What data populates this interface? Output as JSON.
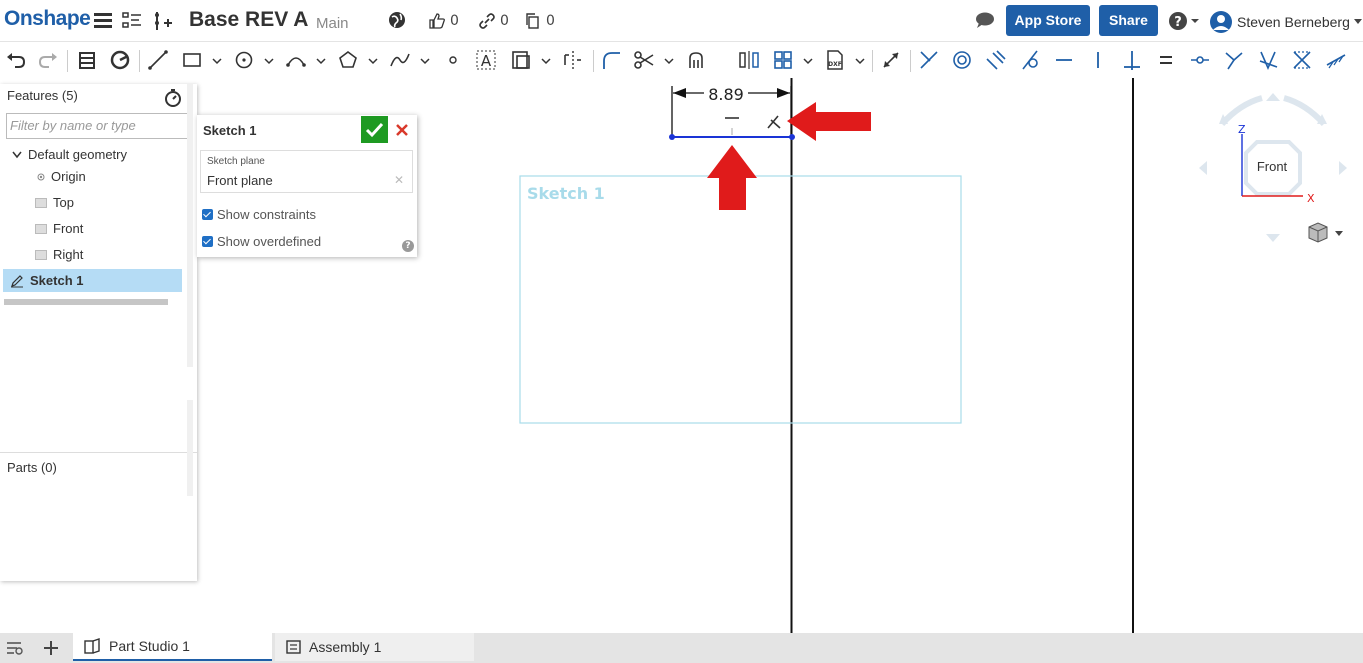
{
  "app": {
    "logo": "Onshape"
  },
  "document": {
    "title": "Base REV A",
    "branch": "Main",
    "likes": "0",
    "links": "0",
    "copies": "0"
  },
  "header": {
    "app_store_label": "App Store",
    "share_label": "Share",
    "user_name": "Steven Berneberg"
  },
  "features_panel": {
    "title": "Features (5)",
    "filter_placeholder": "Filter by name or type",
    "default_geometry_label": "Default geometry",
    "items": [
      "Origin",
      "Top",
      "Front",
      "Right"
    ],
    "selected_item": "Sketch 1",
    "parts_title": "Parts (0)"
  },
  "sketch_dialog": {
    "title": "Sketch 1",
    "plane_label": "Sketch plane",
    "plane_value": "Front plane",
    "show_constraints_label": "Show constraints",
    "show_overdefined_label": "Show overdefined"
  },
  "viewport": {
    "sketch_label": "Sketch 1",
    "dimension_value": "8.89",
    "view_cube_face": "Front",
    "axis_z": "Z",
    "axis_x": "X"
  },
  "bottom_tabs": [
    {
      "label": "Part Studio 1",
      "active": true
    },
    {
      "label": "Assembly 1",
      "active": false
    }
  ],
  "colors": {
    "brand": "#1f5fa8",
    "ok_green": "#1e9a22",
    "cancel_red": "#d9392b",
    "selection": "#b5dcf5",
    "sketch_line": "#1a34d6",
    "annotation_arrow": "#e01b1b"
  }
}
